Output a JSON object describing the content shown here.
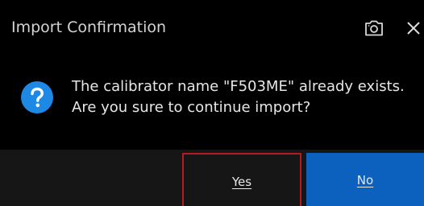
{
  "dialog": {
    "title": "Import Confirmation",
    "message_line1": "The calibrator name \"F503ME\" already exists.",
    "message_line2": "Are you sure to continue import?",
    "icons": {
      "screenshot": "camera-icon",
      "close": "close-icon",
      "question": "question-icon"
    },
    "buttons": {
      "yes_label": "Yes",
      "no_label": "No"
    },
    "colors": {
      "background": "#000000",
      "footer": "#161616",
      "question_icon": "#1e88e5",
      "primary_button": "#0b61bd",
      "focus_border": "#b41b25",
      "text": "#e6e6e6"
    }
  }
}
